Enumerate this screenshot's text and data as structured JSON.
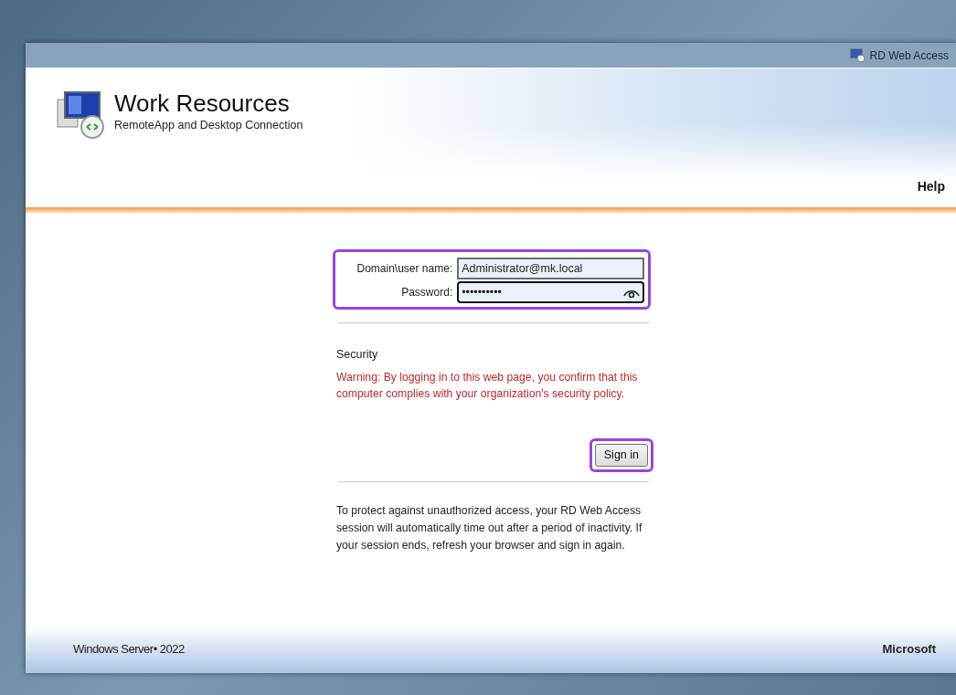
{
  "top_bar": {
    "label": "RD Web Access"
  },
  "header": {
    "title": "Work Resources",
    "subtitle": "RemoteApp and Desktop Connection",
    "help_link": "Help"
  },
  "login_form": {
    "fields": [
      {
        "label": "Domain\\user name:",
        "value": "Administrator@mk.local",
        "kind": "text"
      },
      {
        "label": "Password:",
        "value": "••••••••••",
        "kind": "password"
      }
    ],
    "fields_highlighted": true,
    "security_heading": "Security",
    "warning": "Warning: By logging in to this web page, you confirm that this computer complies with your organization's security policy.",
    "sign_in_button": {
      "label": "Sign in",
      "highlighted": true
    },
    "timeout_note": "To protect against unauthorized access, your RD Web Access session will automatically time out after a period of inactivity. If your session ends, refresh your browser and sign in again."
  },
  "footer": {
    "product": "Windows Server• 2022",
    "vendor": "Microsoft"
  }
}
